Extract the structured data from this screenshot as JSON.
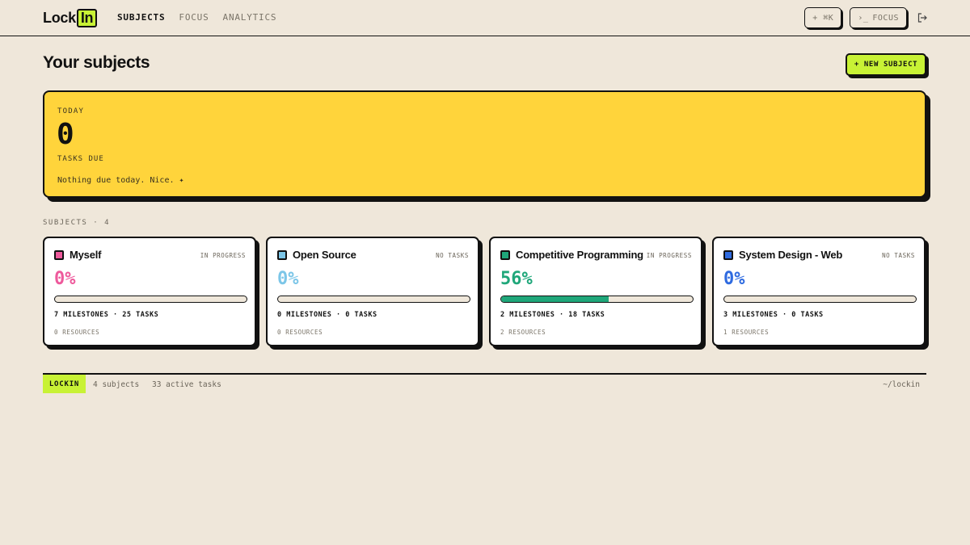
{
  "nav": {
    "logo_text": "Lock",
    "logo_badge": "In",
    "links": [
      {
        "label": "SUBJECTS",
        "active": true
      },
      {
        "label": "FOCUS",
        "active": false
      },
      {
        "label": "ANALYTICS",
        "active": false
      }
    ],
    "command_button": "+ ⌘K",
    "focus_button": "FOCUS",
    "focus_prompt": "›_"
  },
  "header": {
    "title": "Your subjects",
    "new_subject_label": "+ NEW SUBJECT"
  },
  "today": {
    "label": "TODAY",
    "count": "0",
    "count_label": "TASKS DUE",
    "message": "Nothing due today. Nice. ✦",
    "bg_color": "#ffd43b"
  },
  "subjects_section": {
    "label": "SUBJECTS · 4"
  },
  "subjects": [
    {
      "name": "Myself",
      "status": "IN PROGRESS",
      "percent": "0%",
      "progress": 0,
      "milestones": "7 MILESTONES · 25 TASKS",
      "resources": "0 RESOURCES",
      "color": "#ee5a9c"
    },
    {
      "name": "Open Source",
      "status": "NO TASKS",
      "percent": "0%",
      "progress": 0,
      "milestones": "0 MILESTONES · 0 TASKS",
      "resources": "0 RESOURCES",
      "color": "#7cc6e8"
    },
    {
      "name": "Competitive Programming",
      "status": "IN PROGRESS",
      "percent": "56%",
      "progress": 0.56,
      "milestones": "2 MILESTONES · 18 TASKS",
      "resources": "2 RESOURCES",
      "color": "#1fa77a"
    },
    {
      "name": "System Design - Web",
      "status": "NO TASKS",
      "percent": "0%",
      "progress": 0,
      "milestones": "3 MILESTONES · 0 TASKS",
      "resources": "1 RESOURCES",
      "color": "#2f6be0"
    }
  ],
  "statusbar": {
    "tag": "LOCKIN",
    "subjects": "4 subjects",
    "active_tasks": "33 active tasks",
    "path": "~/lockin"
  },
  "colors": {
    "accent": "#c8f235",
    "background": "#efe7da"
  }
}
